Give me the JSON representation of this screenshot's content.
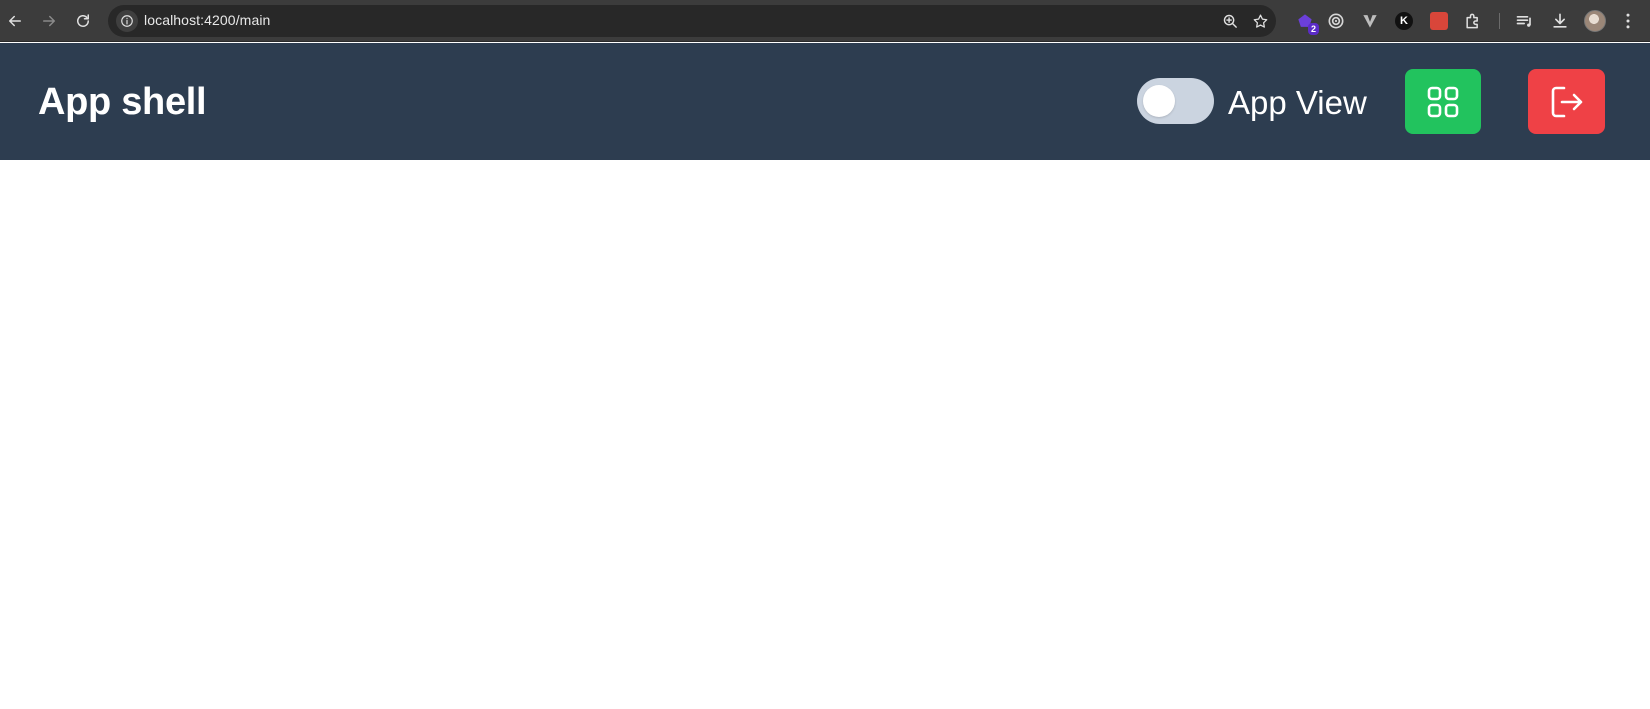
{
  "browser": {
    "url": "localhost:4200/main",
    "extensions": [
      {
        "name": "purple-extension-icon",
        "badge": "2"
      },
      {
        "name": "target-extension-icon"
      },
      {
        "name": "vee-extension-icon"
      },
      {
        "name": "k-extension-icon",
        "letter": "K"
      },
      {
        "name": "red-extension-icon"
      },
      {
        "name": "puzzle-extensions-icon"
      }
    ]
  },
  "header": {
    "title": "App shell",
    "toggle": {
      "label": "App View",
      "state": "off"
    },
    "colors": {
      "background": "#2d3d50",
      "grid_button": "#22c35e",
      "logout_button": "#ef4146",
      "toggle_track": "#cbd4e0"
    }
  }
}
